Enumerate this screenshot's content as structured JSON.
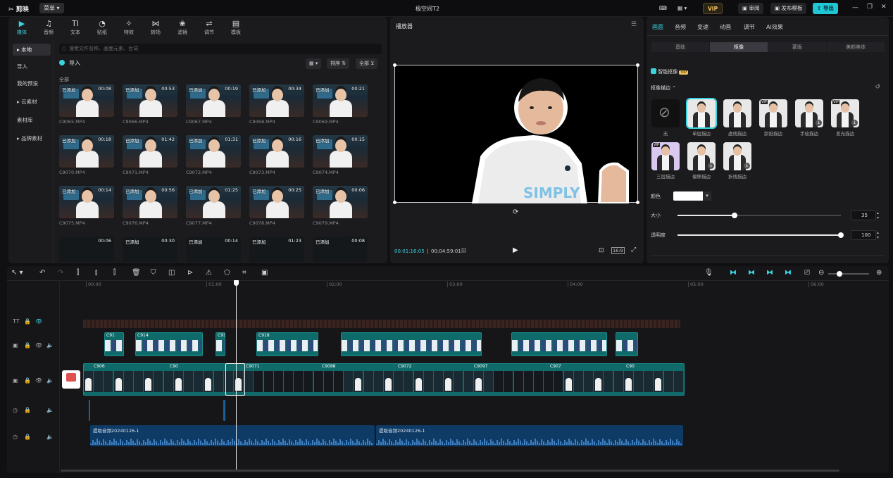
{
  "titlebar": {
    "app_name": "剪映",
    "menu_label": "菜单",
    "project_title": "极空间T2",
    "vip_label": "VIP",
    "review_label": "审阅",
    "publish_template_label": "发布模板",
    "export_label": "导出"
  },
  "media_tabs": [
    {
      "icon": "media-icon",
      "label": "媒体"
    },
    {
      "icon": "audio-icon",
      "label": "音频"
    },
    {
      "icon": "text-icon",
      "label": "文本"
    },
    {
      "icon": "sticker-icon",
      "label": "贴纸"
    },
    {
      "icon": "effects-icon",
      "label": "特效"
    },
    {
      "icon": "transition-icon",
      "label": "转场"
    },
    {
      "icon": "filter-icon",
      "label": "滤镜"
    },
    {
      "icon": "adjust-icon",
      "label": "调节"
    },
    {
      "icon": "template-icon",
      "label": "模板"
    }
  ],
  "left_nav": [
    {
      "label": "▸ 本地",
      "active": true
    },
    {
      "label": "导入",
      "active": false
    },
    {
      "label": "我的预设",
      "active": false
    },
    {
      "label": "▸ 云素材",
      "active": false
    },
    {
      "label": "素材库",
      "active": false
    },
    {
      "label": "▸ 品牌素材",
      "active": false
    }
  ],
  "search": {
    "placeholder": "搜索文件名称、画面元素、台词"
  },
  "import_label": "导入",
  "toolbar_small": {
    "sort_label": "排序",
    "all_label": "全部"
  },
  "section_label": "全部",
  "media_items": [
    {
      "tag": "已添加",
      "duration": "00:08",
      "name": "C9065.MP4",
      "dark": false
    },
    {
      "tag": "已添加",
      "duration": "00:53",
      "name": "C9066.MP4",
      "dark": false
    },
    {
      "tag": "已添加",
      "duration": "00:19",
      "name": "C9067.MP4",
      "dark": false
    },
    {
      "tag": "已添加",
      "duration": "00:34",
      "name": "C9068.MP4",
      "dark": false
    },
    {
      "tag": "已添加",
      "duration": "00:21",
      "name": "C9069.MP4",
      "dark": false
    },
    {
      "tag": "已添加",
      "duration": "00:18",
      "name": "C9070.MP4",
      "dark": false
    },
    {
      "tag": "已添加",
      "duration": "01:42",
      "name": "C9071.MP4",
      "dark": false
    },
    {
      "tag": "已添加",
      "duration": "01:31",
      "name": "C9072.MP4",
      "dark": false
    },
    {
      "tag": "已添加",
      "duration": "00:16",
      "name": "C9073.MP4",
      "dark": false
    },
    {
      "tag": "已添加",
      "duration": "00:15",
      "name": "C9074.MP4",
      "dark": false
    },
    {
      "tag": "已添加",
      "duration": "00:14",
      "name": "C9075.MP4",
      "dark": false
    },
    {
      "tag": "已添加",
      "duration": "00:56",
      "name": "C9076.MP4",
      "dark": false
    },
    {
      "tag": "已添加",
      "duration": "01:25",
      "name": "C9077.MP4",
      "dark": false
    },
    {
      "tag": "已添加",
      "duration": "00:25",
      "name": "C9078.MP4",
      "dark": false
    },
    {
      "tag": "已添加",
      "duration": "00:06",
      "name": "C9079.MP4",
      "dark": false
    },
    {
      "tag": "",
      "duration": "00:06",
      "name": "",
      "dark": true
    },
    {
      "tag": "已添加",
      "duration": "00:30",
      "name": "",
      "dark": true
    },
    {
      "tag": "已添加",
      "duration": "00:14",
      "name": "",
      "dark": true
    },
    {
      "tag": "已添加",
      "duration": "01:23",
      "name": "",
      "dark": true
    },
    {
      "tag": "已添加",
      "duration": "00:08",
      "name": "",
      "dark": true
    }
  ],
  "player": {
    "title": "播放器",
    "current_time": "00:01:16:05",
    "total_time": "00:04:59:01",
    "ratio_label": "16:9",
    "shirt_text": "SIMPLY"
  },
  "props": {
    "tabs": [
      {
        "label": "画面",
        "active": true
      },
      {
        "label": "音频",
        "active": false
      },
      {
        "label": "变速",
        "active": false
      },
      {
        "label": "动画",
        "active": false
      },
      {
        "label": "调节",
        "active": false
      },
      {
        "label": "AI效果",
        "active": false
      }
    ],
    "segments": [
      {
        "label": "基础",
        "active": false
      },
      {
        "label": "抠像",
        "active": true
      },
      {
        "label": "蒙版",
        "active": false
      },
      {
        "label": "美颜美体",
        "active": false
      }
    ],
    "smart_cutout_label": "智能抠像",
    "vip_badge": "VIP",
    "stroke_label": "抠像描边",
    "effects": [
      {
        "label": "无",
        "type": "none"
      },
      {
        "label": "单层描边",
        "type": "sel"
      },
      {
        "label": "虚线描边",
        "type": "plain"
      },
      {
        "label": "卸纸描边",
        "type": "vip"
      },
      {
        "label": "手绘描边",
        "type": "dl"
      },
      {
        "label": "发光描边",
        "type": "vipdl"
      },
      {
        "label": "三层描边",
        "type": "vip"
      },
      {
        "label": "偏移描边",
        "type": "dl"
      },
      {
        "label": "折线描边",
        "type": "dl"
      }
    ],
    "color_label": "颜色",
    "size_label": "大小",
    "size_value": "35",
    "size_fraction": 0.35,
    "opacity_label": "透明度",
    "opacity_value": "100",
    "opacity_fraction": 1.0
  },
  "timeline": {
    "ruler_labels": [
      "00:00",
      "01:00",
      "02:00",
      "03:00",
      "04:00",
      "05:00",
      "06:00"
    ],
    "cover_label": "封面",
    "audio_clip_1": "提取音频20240126-1",
    "audio_clip_2": "提取音频20240126-1",
    "clip_labels_main": [
      "C906",
      "C90",
      "C9071",
      "C9088",
      "C9072",
      "C9097",
      "C907",
      "C90"
    ],
    "clip_labels_overlay": [
      "C91",
      "C914",
      "C91",
      "C918"
    ]
  },
  "colors": {
    "accent": "#3ad3e0",
    "clip": "#0f6a6a",
    "audio": "#0e3a66"
  }
}
